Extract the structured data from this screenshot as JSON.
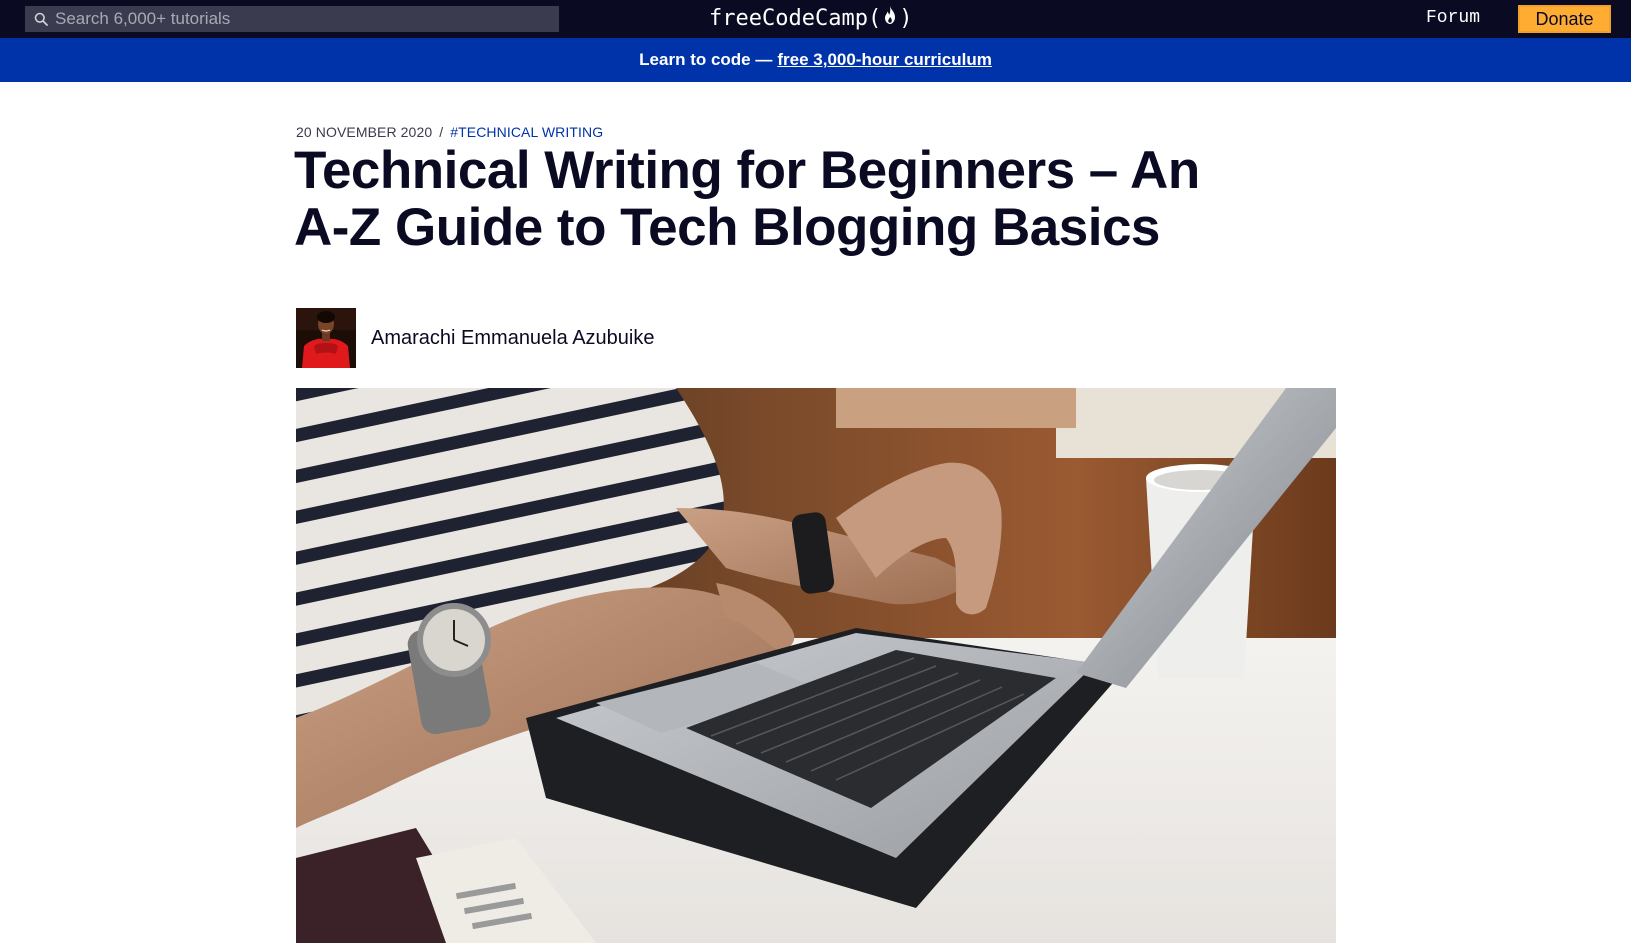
{
  "nav": {
    "search_placeholder": "Search 6,000+ tutorials",
    "brand": "freeCodeCamp",
    "brand_open": "(",
    "brand_close": ")",
    "forum_label": "Forum",
    "donate_label": "Donate"
  },
  "banner": {
    "text": "Learn to code —",
    "link_text": "free 3,000-hour curriculum"
  },
  "article": {
    "date": "20 NOVEMBER 2020",
    "separator": "/",
    "tag": "#TECHNICAL WRITING",
    "title": "Technical Writing for Beginners – An A-Z Guide to Tech Blogging Basics",
    "author": "Amarachi Emmanuela Azubuike"
  },
  "colors": {
    "nav_bg": "#0a0a23",
    "banner_bg": "#0033aa",
    "donate_bg": "#feac32",
    "tag_color": "#0033aa"
  },
  "icons": {
    "search": "search-icon",
    "flame": "flame-icon"
  }
}
